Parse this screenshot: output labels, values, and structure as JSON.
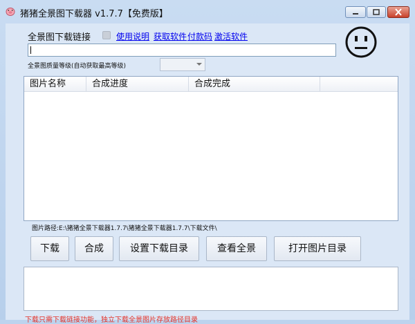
{
  "window": {
    "title": "猪猪全景图下载器 v1.7.7【免费版】",
    "icon": "pig-icon",
    "controls": [
      "minimize-icon",
      "maximize-icon",
      "close-icon"
    ]
  },
  "form": {
    "url_label": "全景图下载链接",
    "links": [
      "使用说明",
      "获取软件",
      "付款码",
      "激活软件"
    ],
    "url_value": "",
    "quality_label": "全景图质量等级(自动获取最高等级)",
    "quality_value": ""
  },
  "table": {
    "columns": [
      "图片名称",
      "合成进度",
      "合成完成",
      ""
    ],
    "rows": []
  },
  "path_text": "图片路径:E:\\猪猪全景下载器1.7.7\\猪猪全景下载器1.7.7\\下载文件\\",
  "buttons": {
    "download": "下载",
    "compose": "合成",
    "set_dir": "设置下载目录",
    "view": "查看全景",
    "open_dir": "打开图片目录"
  },
  "log_text": "",
  "notice": "下载只需下载链接功能，独立下载全景图片存放路径目录",
  "colors": {
    "notice": "#e3332a",
    "link": "#0000ee",
    "background": "#dbe7f6"
  }
}
